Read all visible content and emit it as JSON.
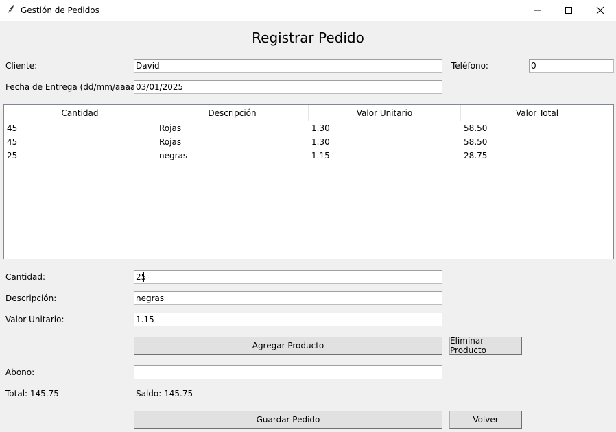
{
  "window": {
    "title": "Gestión de Pedidos"
  },
  "heading": "Registrar Pedido",
  "form": {
    "cliente_label": "Cliente:",
    "cliente_value": "David",
    "telefono_label": "Teléfono:",
    "telefono_value": "0",
    "fecha_label": "Fecha de Entrega (dd/mm/aaaa):",
    "fecha_value": "03/01/2025"
  },
  "table": {
    "columns": [
      "Cantidad",
      "Descripción",
      "Valor Unitario",
      "Valor Total"
    ],
    "rows": [
      [
        "45",
        "Rojas",
        "1.30",
        "58.50"
      ],
      [
        "45",
        "Rojas",
        "1.30",
        "58.50"
      ],
      [
        "25",
        "negras",
        "1.15",
        "28.75"
      ]
    ]
  },
  "product": {
    "cantidad_label": "Cantidad:",
    "cantidad_value": "25",
    "descripcion_label": "Descripción:",
    "descripcion_value": "negras",
    "valor_label": "Valor Unitario:",
    "valor_value": "1.15",
    "add_button": "Agregar Producto",
    "remove_button": "Eliminar Producto"
  },
  "payment": {
    "abono_label": "Abono:",
    "abono_value": "",
    "total_text": "Total: 145.75",
    "saldo_text": "Saldo: 145.75"
  },
  "actions": {
    "save_button": "Guardar Pedido",
    "back_button": "Volver"
  }
}
